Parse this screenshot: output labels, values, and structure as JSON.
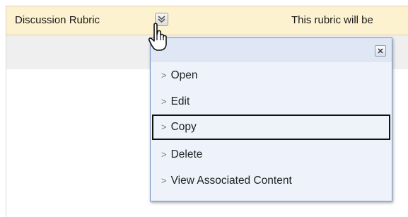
{
  "header": {
    "rubric_title": "Discussion Rubric",
    "note": "This rubric will be",
    "toggle_icon": "chevron-down-icon"
  },
  "context_menu": {
    "close_icon": "close-icon",
    "items": [
      {
        "label": "Open"
      },
      {
        "label": "Edit"
      },
      {
        "label": "Copy",
        "focused": true
      },
      {
        "label": "Delete"
      },
      {
        "label": "View Associated Content"
      }
    ]
  },
  "cursor": {
    "icon": "hand-pointer-icon"
  },
  "colors": {
    "header_bg": "#fdf2cf",
    "menu_bg": "#eef3fb",
    "menu_border": "#7a96c4"
  }
}
